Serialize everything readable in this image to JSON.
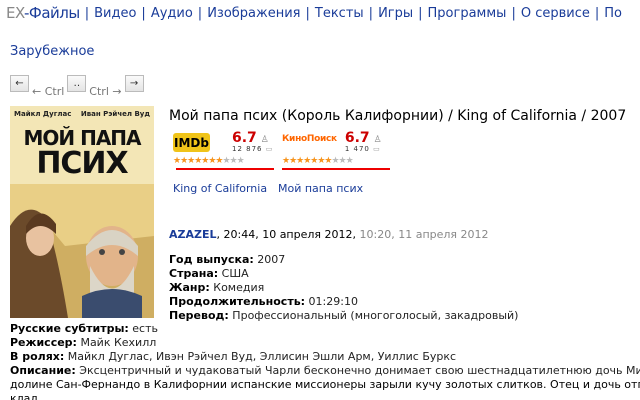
{
  "nav": {
    "logo_prefix": "EX",
    "logo_suffix": "-Файлы",
    "items": [
      "Видео",
      "Аудио",
      "Изображения",
      "Тексты",
      "Игры",
      "Программы",
      "О сервисе",
      "По"
    ]
  },
  "breadcrumb": "Зарубежное",
  "pager": {
    "prev_label": "← Ctrl",
    "next_label": "Ctrl →",
    "prev_icon": "←",
    "next_icon": "→",
    "up_icon": "‥"
  },
  "poster": {
    "actor_left": "Майкл Дуглас",
    "actor_right": "Иван Рэйчел Вуд",
    "title_line1": "МОЙ ПАПА",
    "title_line2": "ПСИХ"
  },
  "title": "Мой папа псих (Король Калифорнии) / King of California / 2007",
  "imdb": {
    "logo": "IMDb",
    "rating": "6.7",
    "votes": "12 876",
    "stars": 6.7
  },
  "kinopoisk": {
    "logo": "КиноПоиск",
    "rating": "6.7",
    "votes": "1 470",
    "stars": 6.7
  },
  "alt_titles": [
    "King of California",
    "Мой папа псих"
  ],
  "post": {
    "author": "AZAZEL",
    "created": ", 20:44, 10 апреля 2012,",
    "updated": " 10:20, 11 апреля 2012"
  },
  "details": [
    {
      "label": "Год выпуска:",
      "value": " 2007"
    },
    {
      "label": "Страна:",
      "value": " США"
    },
    {
      "label": "Жанр:",
      "value": " Комедия"
    },
    {
      "label": "Продолжительность:",
      "value": " 01:29:10"
    },
    {
      "label": "Перевод:",
      "value": " Профессиональный (многоголосый, закадровый)"
    }
  ],
  "info": [
    {
      "label": "Русские субтитры:",
      "value": " есть"
    },
    {
      "label": "Режиссер:",
      "value": " Майк Кехилл"
    },
    {
      "label": "В ролях:",
      "value": " Майкл Дуглас, Ивэн Рэйчел Вуд, Эллисин Эшли Арм, Уиллис Буркс"
    },
    {
      "label": "Описание:",
      "value": " Эксцентричный и чудаковатый Чарли бесконечно донимает свою шестнадцатилетнюю дочь Мира"
    }
  ],
  "description_line2": "долине Сан-Фернандо в Калифорнии испанские миссионеры зарыли кучу золотых слитков. Отец и дочь отпр",
  "description_line3": "клад",
  "colors": {
    "link": "#1a3c99",
    "rating": "#cc0000",
    "star": "#f7941d",
    "underline": "#ee0000",
    "imdb": "#f0c419",
    "kinopoisk": "#ff6600"
  }
}
